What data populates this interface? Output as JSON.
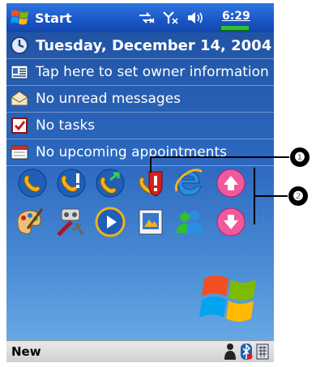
{
  "taskbar": {
    "start_label": "Start",
    "clock": "6:29",
    "icons": [
      "connectivity-icon",
      "signal-off-icon",
      "speaker-icon",
      "battery-icon"
    ]
  },
  "today": {
    "date": "Tuesday, December 14, 2004",
    "owner": "Tap here to set owner information",
    "messages": "No unread messages",
    "tasks": "No tasks",
    "appointments": "No upcoming appointments"
  },
  "launcher": {
    "row1": [
      "phone-icon",
      "phone-alert-icon",
      "phone-forward-icon",
      "security-phone-icon",
      "internet-explorer-icon",
      "scroll-up-icon"
    ],
    "row2": [
      "paint-icon",
      "media-tools-icon",
      "media-player-icon",
      "picture-viewer-icon",
      "messenger-icon",
      "scroll-down-icon"
    ]
  },
  "footer": {
    "new_label": "New",
    "tray_icons": [
      "person-icon",
      "bluetooth-icon",
      "keyboard-icon"
    ]
  },
  "callouts": [
    "❶",
    "❷"
  ]
}
